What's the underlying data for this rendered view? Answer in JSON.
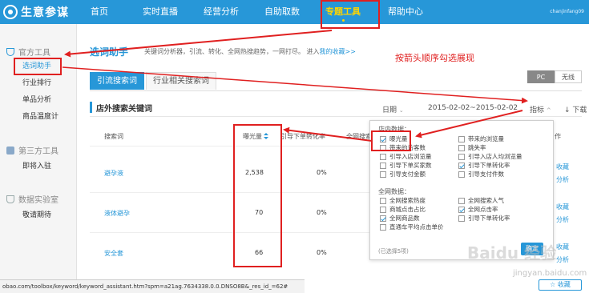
{
  "app": {
    "name": "生意参谋",
    "user": "chanjinfang09"
  },
  "nav": [
    {
      "label": "首页"
    },
    {
      "label": "实时直播"
    },
    {
      "label": "经营分析"
    },
    {
      "label": "自助取数"
    },
    {
      "label": "专题工具"
    },
    {
      "label": "帮助中心"
    }
  ],
  "sidebar": {
    "sections": [
      {
        "title": "官方工具",
        "items": [
          "选词助手",
          "行业排行",
          "单品分析",
          "商品温度计"
        ]
      },
      {
        "title": "第三方工具",
        "items": [
          "即将入驻"
        ]
      },
      {
        "title": "数据实验室",
        "items": [
          "敬请期待"
        ]
      }
    ]
  },
  "page": {
    "title": "选词助手",
    "subtitle": "关键词分析器，引流、转化、全网热搜趋势，一网打尽。 进入",
    "subtitle_link": "我的收藏>>",
    "annotation": "按箭头顺序勾选展现"
  },
  "tabs": [
    "引流搜索词",
    "行业相关搜索词"
  ],
  "device": {
    "pc": "PC",
    "wireless": "无线"
  },
  "panel": {
    "title": "店外搜索关键词",
    "date_label": "日期",
    "date_range": "2015-02-02~2015-02-02",
    "metrics_label": "指标",
    "download": "下载"
  },
  "table": {
    "headers": [
      "搜索词",
      "曝光量",
      "引导下单转化率",
      "全网搜索"
    ],
    "rows": [
      {
        "keyword": "避孕液",
        "exposure": "2,538",
        "conversion": "0%"
      },
      {
        "keyword": "液体避孕",
        "exposure": "70",
        "conversion": "0%"
      },
      {
        "keyword": "安全套",
        "exposure": "66",
        "conversion": "0%"
      }
    ],
    "action_header": "作",
    "collect_label": "收藏",
    "analyze_label": "分析"
  },
  "metrics_popup": {
    "group1_title": "店内数据：",
    "group1": [
      {
        "label": "曝光量",
        "checked": true
      },
      {
        "label": "带来的浏览量",
        "checked": false
      },
      {
        "label": "带来的访客数",
        "checked": false
      },
      {
        "label": "跳失率",
        "checked": false
      },
      {
        "label": "引导入店浏览量",
        "checked": false
      },
      {
        "label": "引导入店人均浏览量",
        "checked": false
      },
      {
        "label": "引导下单买家数",
        "checked": false
      },
      {
        "label": "引导下单转化率",
        "checked": true
      },
      {
        "label": "引导支付金额",
        "checked": false
      },
      {
        "label": "引导支付件数",
        "checked": false
      }
    ],
    "group2_title": "全网数据：",
    "group2": [
      {
        "label": "全网搜索热度",
        "checked": false
      },
      {
        "label": "全网搜索人气",
        "checked": false
      },
      {
        "label": "商城点击占比",
        "checked": false
      },
      {
        "label": "全网点击率",
        "checked": true
      },
      {
        "label": "全网商品数",
        "checked": true
      },
      {
        "label": "引导下单转化率",
        "checked": false
      },
      {
        "label": "直通车平均点击单价",
        "checked": false
      }
    ],
    "selected_count": "(已选择5项)",
    "confirm": "确定"
  },
  "status_url": "obao.com/toolbox/keyword/keyword_assistant.htm?spm=a21ag.7634338.0.0.DNSO8B&_res_id_=62#",
  "watermark": {
    "main": "Baidu 经验",
    "sub": "jingyan.baidu.com"
  },
  "colors": {
    "brand": "#2797d8",
    "highlight": "#e02020",
    "active_nav": "#ffd400"
  }
}
